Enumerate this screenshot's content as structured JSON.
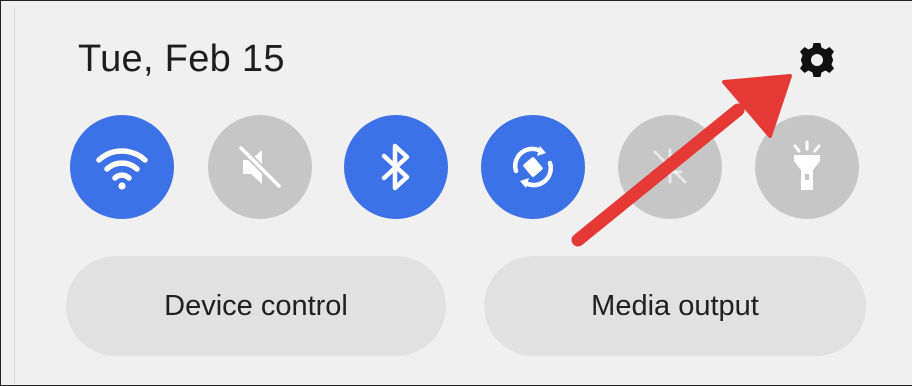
{
  "header": {
    "date": "Tue, Feb 15",
    "settings_icon": "gear-icon"
  },
  "quick_toggles": [
    {
      "name": "wifi",
      "icon": "wifi-icon",
      "state": "on"
    },
    {
      "name": "sound",
      "icon": "mute-icon",
      "state": "off"
    },
    {
      "name": "bluetooth",
      "icon": "bluetooth-icon",
      "state": "on"
    },
    {
      "name": "auto-rotate",
      "icon": "auto-rotate-icon",
      "state": "on"
    },
    {
      "name": "airplane-mode",
      "icon": "airplane-icon",
      "state": "off"
    },
    {
      "name": "flashlight",
      "icon": "flashlight-icon",
      "state": "off"
    }
  ],
  "buttons": {
    "device_control": "Device control",
    "media_output": "Media output"
  },
  "colors": {
    "toggle_on": "#3d71e8",
    "toggle_off": "#c6c6c6",
    "arrow": "#e53935"
  }
}
